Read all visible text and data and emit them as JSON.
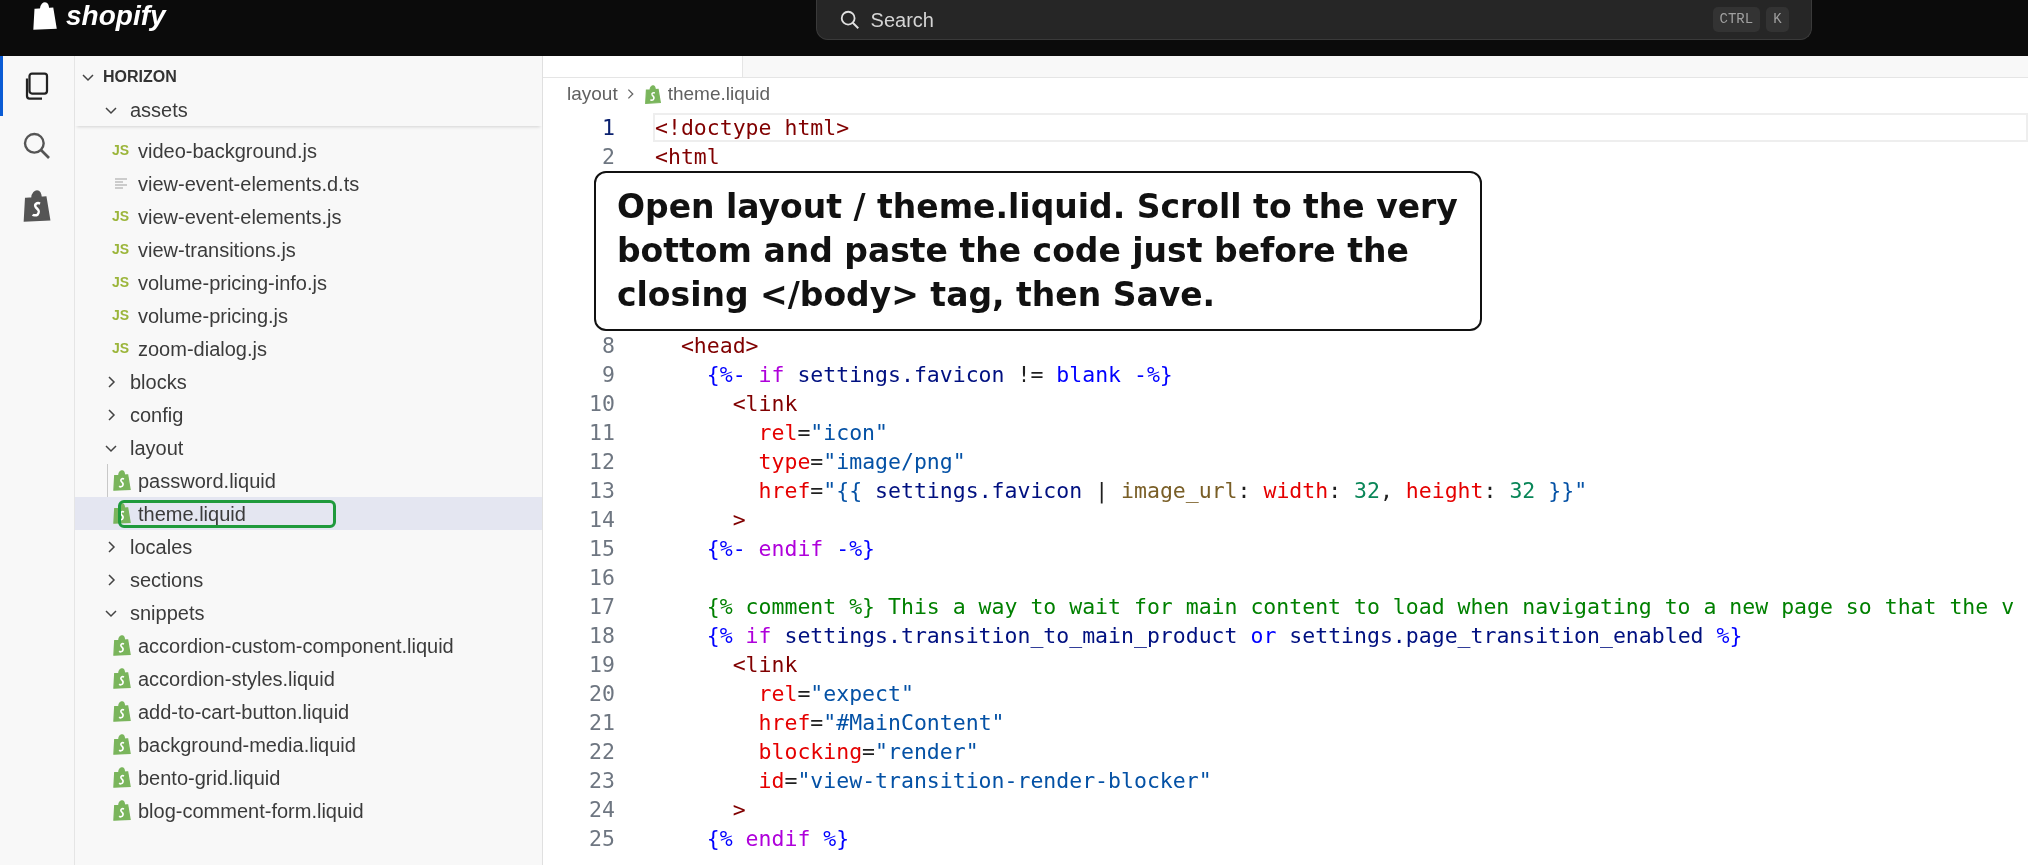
{
  "top_bar": {
    "logo_text": "shopify",
    "search": {
      "placeholder": "Search",
      "shortcut": [
        "CTRL",
        "K"
      ]
    }
  },
  "activity_bar": [
    {
      "kind": "files",
      "selected": true
    },
    {
      "kind": "search",
      "selected": false
    },
    {
      "kind": "shopify",
      "selected": false
    }
  ],
  "explorer": {
    "root": {
      "label": "HORIZON",
      "kind": "folder",
      "expanded": true,
      "selected": false,
      "circled": false,
      "children": [
        {
          "label": "assets",
          "kind": "folder",
          "expanded": true,
          "selected": false,
          "circled": false,
          "children": [
            {
              "label": "video-background.js",
              "kind": "js",
              "badge": "JS",
              "selected": false,
              "circled": false
            },
            {
              "label": "view-event-elements.d.ts",
              "kind": "text",
              "selected": false,
              "circled": false
            },
            {
              "label": "view-event-elements.js",
              "kind": "js",
              "badge": "JS",
              "selected": false,
              "circled": false
            },
            {
              "label": "view-transitions.js",
              "kind": "js",
              "badge": "JS",
              "selected": false,
              "circled": false
            },
            {
              "label": "volume-pricing-info.js",
              "kind": "js",
              "badge": "JS",
              "selected": false,
              "circled": false
            },
            {
              "label": "volume-pricing.js",
              "kind": "js",
              "badge": "JS",
              "selected": false,
              "circled": false
            },
            {
              "label": "zoom-dialog.js",
              "kind": "js",
              "badge": "JS",
              "selected": false,
              "circled": false
            }
          ]
        },
        {
          "label": "blocks",
          "kind": "folder",
          "expanded": false,
          "selected": false,
          "circled": false
        },
        {
          "label": "config",
          "kind": "folder",
          "expanded": false,
          "selected": false,
          "circled": false
        },
        {
          "label": "layout",
          "kind": "folder",
          "expanded": true,
          "selected": false,
          "circled": false,
          "children": [
            {
              "label": "password.liquid",
              "kind": "liquid",
              "selected": false,
              "circled": false
            },
            {
              "label": "theme.liquid",
              "kind": "liquid",
              "selected": true,
              "circled": true
            }
          ]
        },
        {
          "label": "locales",
          "kind": "folder",
          "expanded": false,
          "selected": false,
          "circled": false
        },
        {
          "label": "sections",
          "kind": "folder",
          "expanded": false,
          "selected": false,
          "circled": false
        },
        {
          "label": "snippets",
          "kind": "folder",
          "expanded": true,
          "selected": false,
          "circled": false,
          "children": [
            {
              "label": "accordion-custom-component.liquid",
              "kind": "liquid",
              "selected": false,
              "circled": false
            },
            {
              "label": "accordion-styles.liquid",
              "kind": "liquid",
              "selected": false,
              "circled": false
            },
            {
              "label": "add-to-cart-button.liquid",
              "kind": "liquid",
              "selected": false,
              "circled": false
            },
            {
              "label": "background-media.liquid",
              "kind": "liquid",
              "selected": false,
              "circled": false
            },
            {
              "label": "bento-grid.liquid",
              "kind": "liquid",
              "selected": false,
              "circled": false
            },
            {
              "label": "blog-comment-form.liquid",
              "kind": "liquid",
              "selected": false,
              "circled": false
            }
          ]
        }
      ]
    }
  },
  "editor": {
    "breadcrumb": [
      {
        "label": "layout",
        "kind": "folder"
      },
      {
        "label": "theme.liquid",
        "kind": "liquid"
      }
    ],
    "lines_before_callout": [
      {
        "number": "1",
        "current": true,
        "tokens": [
          {
            "kind": "tag",
            "text": "<!doctype html>"
          }
        ]
      },
      {
        "number": "2",
        "current": false,
        "tokens": [
          {
            "kind": "tag",
            "text": "<html"
          }
        ]
      }
    ],
    "callout": {
      "text": "Open layout / theme.liquid. Scroll to the very bottom and paste the code just before the closing </body> tag, then Save."
    },
    "lines_after_callout": [
      {
        "number": "8",
        "current": false,
        "tokens": [
          {
            "kind": "tag",
            "text": "  <head>"
          }
        ]
      },
      {
        "number": "9",
        "current": false,
        "tokens": [
          {
            "kind": "delim",
            "text": "    {%-"
          },
          {
            "kind": "keyword",
            "text": " if"
          },
          {
            "kind": "var",
            "text": " settings.favicon"
          },
          {
            "kind": "plain",
            "text": " != "
          },
          {
            "kind": "delim",
            "text": "blank -%}"
          }
        ]
      },
      {
        "number": "10",
        "current": false,
        "tokens": [
          {
            "kind": "tag",
            "text": "      <link"
          }
        ]
      },
      {
        "number": "11",
        "current": false,
        "tokens": [
          {
            "kind": "attr",
            "text": "        rel"
          },
          {
            "kind": "plain",
            "text": "="
          },
          {
            "kind": "string",
            "text": "\"icon\""
          }
        ]
      },
      {
        "number": "12",
        "current": false,
        "tokens": [
          {
            "kind": "attr",
            "text": "        type"
          },
          {
            "kind": "plain",
            "text": "="
          },
          {
            "kind": "string",
            "text": "\"image/png\""
          }
        ]
      },
      {
        "number": "13",
        "current": false,
        "tokens": [
          {
            "kind": "attr",
            "text": "        href"
          },
          {
            "kind": "plain",
            "text": "="
          },
          {
            "kind": "string",
            "text": "\"{{"
          },
          {
            "kind": "var",
            "text": " settings.favicon"
          },
          {
            "kind": "plain",
            "text": " | "
          },
          {
            "kind": "filter",
            "text": "image_url"
          },
          {
            "kind": "plain",
            "text": ": "
          },
          {
            "kind": "attr",
            "text": "width"
          },
          {
            "kind": "plain",
            "text": ": "
          },
          {
            "kind": "number",
            "text": "32"
          },
          {
            "kind": "plain",
            "text": ", "
          },
          {
            "kind": "attr",
            "text": "height"
          },
          {
            "kind": "plain",
            "text": ": "
          },
          {
            "kind": "number",
            "text": "32"
          },
          {
            "kind": "string",
            "text": " }}\""
          }
        ]
      },
      {
        "number": "14",
        "current": false,
        "tokens": [
          {
            "kind": "tag",
            "text": "      >"
          }
        ]
      },
      {
        "number": "15",
        "current": false,
        "tokens": [
          {
            "kind": "delim",
            "text": "    {%-"
          },
          {
            "kind": "keyword",
            "text": " endif"
          },
          {
            "kind": "delim",
            "text": " -%}"
          }
        ]
      },
      {
        "number": "16",
        "current": false
      },
      {
        "number": "17",
        "current": false,
        "tokens": [
          {
            "kind": "comment",
            "text": "    {% comment %} This a way to wait for main content to load when navigating to a new page so that the v"
          }
        ]
      },
      {
        "number": "18",
        "current": false,
        "tokens": [
          {
            "kind": "delim",
            "text": "    {%"
          },
          {
            "kind": "keyword",
            "text": " if"
          },
          {
            "kind": "var",
            "text": " settings.transition_to_main_product"
          },
          {
            "kind": "delim",
            "text": " or"
          },
          {
            "kind": "var",
            "text": " settings.page_transition_enabled"
          },
          {
            "kind": "delim",
            "text": " %}"
          }
        ]
      },
      {
        "number": "19",
        "current": false,
        "tokens": [
          {
            "kind": "tag",
            "text": "      <link"
          }
        ]
      },
      {
        "number": "20",
        "current": false,
        "tokens": [
          {
            "kind": "attr",
            "text": "        rel"
          },
          {
            "kind": "plain",
            "text": "="
          },
          {
            "kind": "string",
            "text": "\"expect\""
          }
        ]
      },
      {
        "number": "21",
        "current": false,
        "tokens": [
          {
            "kind": "attr",
            "text": "        href"
          },
          {
            "kind": "plain",
            "text": "="
          },
          {
            "kind": "string",
            "text": "\"#MainContent\""
          }
        ]
      },
      {
        "number": "22",
        "current": false,
        "tokens": [
          {
            "kind": "attr",
            "text": "        blocking"
          },
          {
            "kind": "plain",
            "text": "="
          },
          {
            "kind": "string",
            "text": "\"render\""
          }
        ]
      },
      {
        "number": "23",
        "current": false,
        "tokens": [
          {
            "kind": "attr",
            "text": "        id"
          },
          {
            "kind": "plain",
            "text": "="
          },
          {
            "kind": "string",
            "text": "\"view-transition-render-blocker\""
          }
        ]
      },
      {
        "number": "24",
        "current": false,
        "tokens": [
          {
            "kind": "tag",
            "text": "      >"
          }
        ]
      },
      {
        "number": "25",
        "current": false,
        "tokens": [
          {
            "kind": "delim",
            "text": "    {%"
          },
          {
            "kind": "keyword",
            "text": " endif"
          },
          {
            "kind": "delim",
            "text": " %}"
          }
        ]
      }
    ]
  }
}
